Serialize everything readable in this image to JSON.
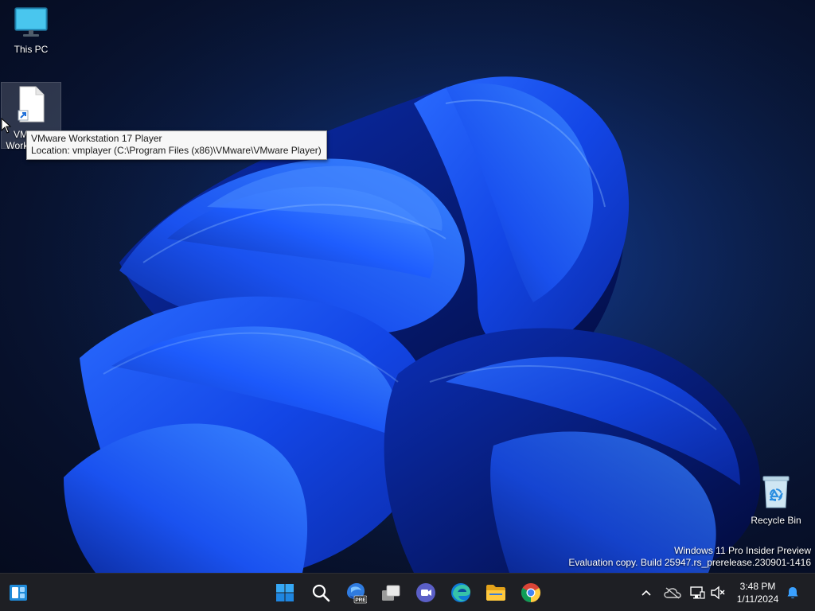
{
  "desktop": {
    "icons": [
      {
        "label": "This PC"
      },
      {
        "label": "VMware Workstation 17 Player"
      },
      {
        "label": "Recycle Bin"
      }
    ],
    "tooltip": {
      "title": "VMware Workstation 17 Player",
      "location": "Location: vmplayer (C:\\Program Files (x86)\\VMware\\VMware Player)"
    },
    "watermark": {
      "line1": "Windows 11 Pro Insider Preview",
      "line2": "Evaluation copy. Build 25947.rs_prerelease.230901-1416"
    }
  },
  "taskbar": {
    "pinned": [
      {
        "name": "Widgets",
        "icon": "widgets-icon"
      },
      {
        "name": "Start",
        "icon": "windows-logo-icon"
      },
      {
        "name": "Search",
        "icon": "search-icon"
      },
      {
        "name": "Copilot",
        "icon": "copilot-pre-icon",
        "badge": "PRE"
      },
      {
        "name": "Task View",
        "icon": "task-view-icon"
      },
      {
        "name": "Teams Chat",
        "icon": "teams-icon"
      },
      {
        "name": "Microsoft Edge",
        "icon": "edge-icon"
      },
      {
        "name": "File Explorer",
        "icon": "folder-icon"
      },
      {
        "name": "Google Chrome",
        "icon": "chrome-icon"
      }
    ],
    "tray": {
      "icons": [
        "chevron-up-icon",
        "onedrive-offline-icon",
        "network-icon",
        "volume-muted-icon",
        "bell-icon"
      ],
      "time": "3:48 PM",
      "date": "1/11/2024"
    }
  },
  "colors": {
    "accent": "#0a5cff",
    "taskbar": "#1e1f24",
    "tooltip_bg": "#f7f7f7",
    "teams": "#5b5fc7",
    "folder": "#ffc83d"
  }
}
